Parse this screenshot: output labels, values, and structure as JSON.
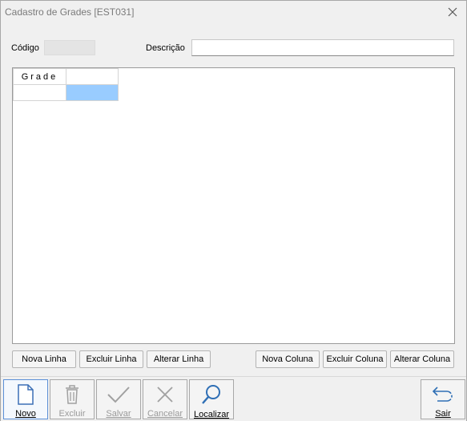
{
  "window": {
    "title": "Cadastro de Grades [EST031]"
  },
  "form": {
    "codigo_label": "Código",
    "codigo_value": "",
    "descricao_label": "Descrição",
    "descricao_value": ""
  },
  "grid": {
    "header": [
      "Grade",
      ""
    ],
    "rows": [
      [
        "",
        ""
      ]
    ]
  },
  "grid_buttons": {
    "nova_linha": "Nova Linha",
    "excluir_linha": "Excluir Linha",
    "alterar_linha": "Alterar Linha",
    "nova_coluna": "Nova Coluna",
    "excluir_coluna": "Excluir Coluna",
    "alterar_coluna": "Alterar Coluna"
  },
  "toolbar": {
    "novo": "Novo",
    "excluir": "Excluir",
    "salvar": "Salvar",
    "cancelar": "Cancelar",
    "localizar": "Localizar",
    "sair": "Sair"
  },
  "colors": {
    "selected_cell": "#99ccff",
    "active_border": "#5b8fd6",
    "disabled_icon": "#a0a0a0",
    "sair_icon": "#2f6fb5"
  },
  "icons": {
    "novo": "new-document-icon",
    "excluir": "trash-icon",
    "salvar": "checkmark-icon",
    "cancelar": "x-icon",
    "localizar": "magnifier-icon",
    "sair": "return-arrow-icon",
    "close": "close-icon"
  }
}
